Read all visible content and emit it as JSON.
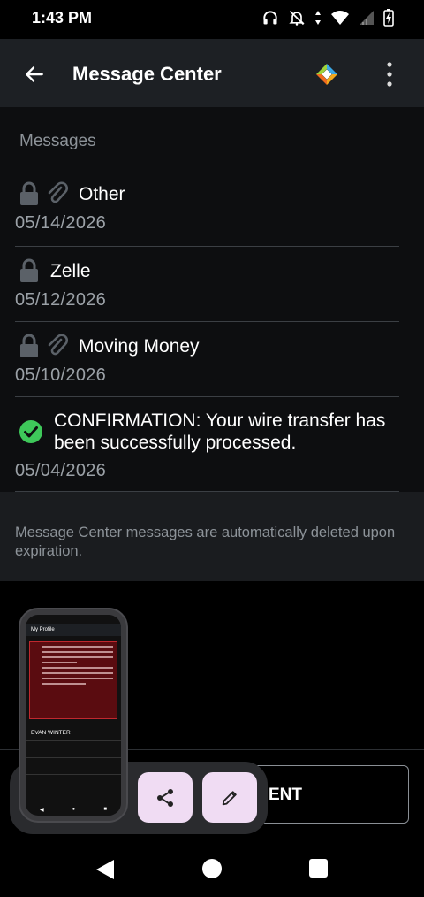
{
  "status_bar": {
    "time": "1:43 PM",
    "icons": [
      "headphones-icon",
      "bell-off-icon",
      "data-arrows-icon",
      "wifi-icon",
      "signal-icon",
      "battery-charging-icon"
    ]
  },
  "app_bar": {
    "title": "Message Center",
    "back_icon": "arrow-left-icon",
    "menu_icon": "more-vert-icon"
  },
  "messages": {
    "header": "Messages",
    "items": [
      {
        "title": "Other",
        "date": "05/14/2026",
        "icons": [
          "lock-icon",
          "paperclip-icon"
        ]
      },
      {
        "title": "Zelle",
        "date": "05/12/2026",
        "icons": [
          "lock-icon"
        ]
      },
      {
        "title": "Moving Money",
        "date": "05/10/2026",
        "icons": [
          "lock-icon",
          "paperclip-icon"
        ]
      },
      {
        "title": "CONFIRMATION: Your wire transfer has been successfully processed.",
        "date": "05/04/2026",
        "icons": [
          "check-circle-icon"
        ]
      }
    ]
  },
  "notice": {
    "text": "Message Center messages are automatically deleted upon expiration."
  },
  "bottom": {
    "button_label": "ENT"
  },
  "screenshot_thumbnail": {
    "title": "My Profile",
    "name": "EVAN WINTER"
  },
  "colors": {
    "app_bar": "#1d2024",
    "content_bg": "#0d0e10",
    "accent_check": "#3ec85a",
    "tool_button": "#f0dcf3"
  }
}
